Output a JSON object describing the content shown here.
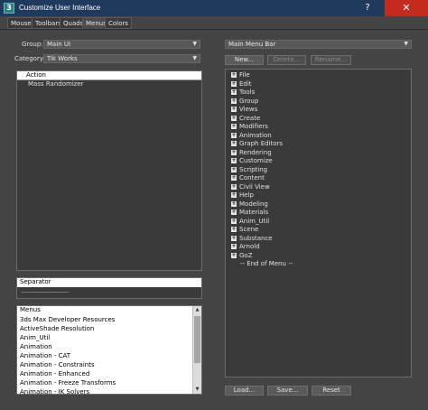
{
  "window": {
    "title": "Customize User Interface",
    "app_icon_glyph": "3",
    "help_glyph": "?",
    "close_glyph": "✕"
  },
  "tabs": [
    {
      "label": "Mouse",
      "active": false
    },
    {
      "label": "Toolbars",
      "active": false
    },
    {
      "label": "Quads",
      "active": false
    },
    {
      "label": "Menus",
      "active": true
    },
    {
      "label": "Colors",
      "active": false
    }
  ],
  "left": {
    "group_label": "Group:",
    "group_value": "Main UI",
    "category_label": "Category:",
    "category_value": "Tik Works",
    "action_header": "Action",
    "actions": [
      "Mass Randomizer"
    ],
    "separator_header": "Separator",
    "separator_line": "--------------------------------",
    "menus_header": "Menus",
    "menus": [
      "3ds Max Developer Resources",
      "ActiveShade Resolution",
      "Anim_Util",
      "Animation",
      "Animation - CAT",
      "Animation - Constraints",
      "Animation - Enhanced",
      "Animation - Freeze Transforms",
      "Animation - IK Solvers"
    ]
  },
  "right": {
    "menu_select_value": "Main Menu Bar",
    "new_label": "New...",
    "delete_label": "Delete...",
    "rename_label": "Rename...",
    "menu_items": [
      "File",
      "Edit",
      "Tools",
      "Group",
      "Views",
      "Create",
      "Modifiers",
      "Animation",
      "Graph Editors",
      "Rendering",
      "Customize",
      "Scripting",
      "Content",
      "Civil View",
      "Help",
      "Modeling",
      "Materials",
      "Anim_Util",
      "Scene",
      "Substance",
      "Arnold",
      "GoZ"
    ],
    "end_of_menu": "-- End of Menu --",
    "load_label": "Load...",
    "save_label": "Save...",
    "reset_label": "Reset"
  },
  "icons": {
    "dropdown": "chevron-down-icon",
    "expand": "plus-box-icon"
  },
  "colors": {
    "titlebar": "#1f3a5c",
    "close": "#c42b1c",
    "panel": "#3a3a3a",
    "background": "#444444"
  }
}
